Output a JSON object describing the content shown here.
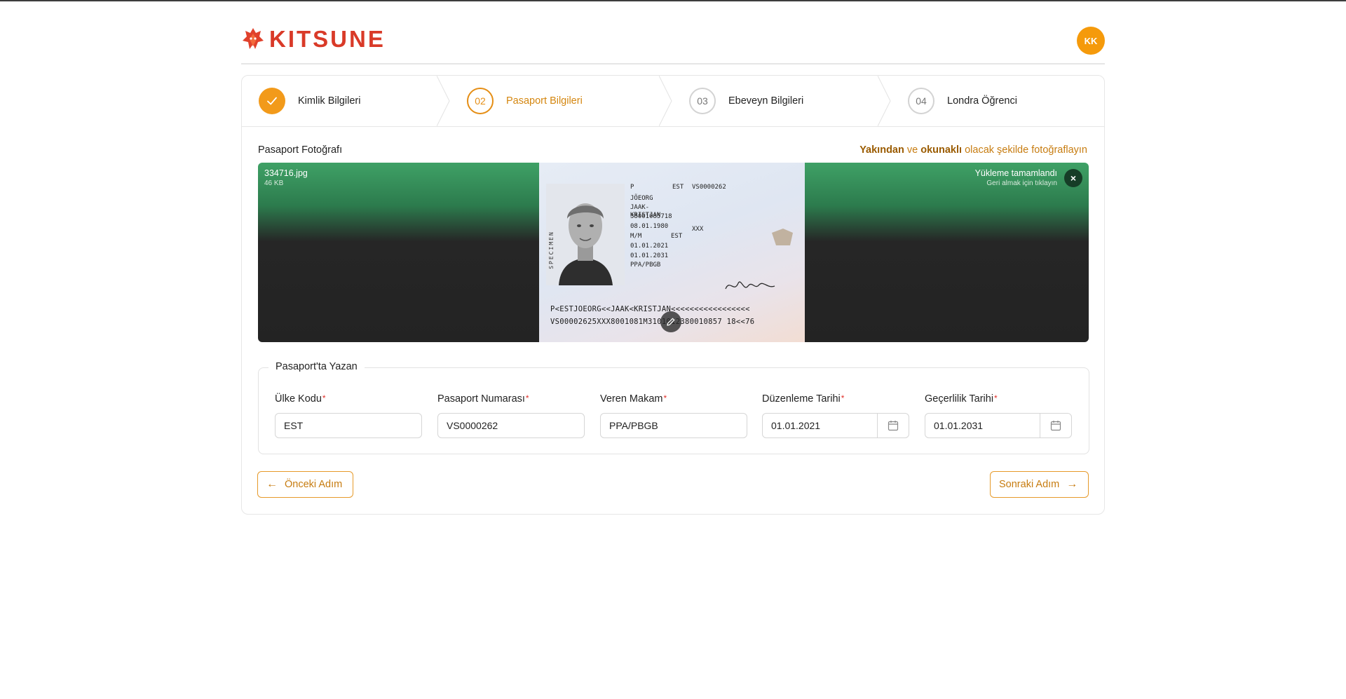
{
  "brand": {
    "name": "KITSUNE",
    "logo_icon": "fox-icon",
    "color": "#d93a28"
  },
  "user": {
    "initials": "KK",
    "color": "#f59a0b"
  },
  "steps": [
    {
      "number": "",
      "label": "Kimlik Bilgileri",
      "state": "done",
      "icon": "check-icon"
    },
    {
      "number": "02",
      "label": "Pasaport Bilgileri",
      "state": "active"
    },
    {
      "number": "03",
      "label": "Ebeveyn Bilgileri",
      "state": "pending"
    },
    {
      "number": "04",
      "label": "Londra Öğrenci",
      "state": "pending"
    }
  ],
  "photo_section": {
    "title": "Pasaport Fotoğrafı",
    "hint_bold1": "Yakından",
    "hint_mid": " ve ",
    "hint_bold2": "okunaklı",
    "hint_end": " olacak şekilde fotoğraflayın"
  },
  "upload": {
    "file_name": "334716.jpg",
    "file_size": "46 KB",
    "status": "Yükleme tamamlandı",
    "status_sub": "Geri almak için tıklayın",
    "close_icon": "close-icon",
    "edit_icon": "edit-icon"
  },
  "passport_image": {
    "specimen": "SPECIMEN",
    "type": "P",
    "country": "EST",
    "number": "VS0000262",
    "surname": "JÕEORG",
    "given_names": "JAAK-KRISTJAN",
    "personal_code": "38001085718",
    "birth_date": "08.01.1980",
    "sex": "M/M",
    "place_of_birth": "EST",
    "issue_date": "01.01.2021",
    "expiry_date": "01.01.2031",
    "authority": "PPA/PBGB",
    "height": "XXX",
    "mrz1": "P<ESTJOEORG<<JAAK<KRISTJAN<<<<<<<<<<<<<<<<<",
    "mrz2": "VS00002625XXX8001081M3101012380010857 18<<76"
  },
  "passport_form": {
    "legend": "Pasaport'ta Yazan",
    "required_mark": "*",
    "fields": [
      {
        "label": "Ülke Kodu",
        "value": "EST"
      },
      {
        "label": "Pasaport Numarası",
        "value": "VS0000262"
      },
      {
        "label": "Veren Makam",
        "value": "PPA/PBGB"
      },
      {
        "label": "Düzenleme Tarihi",
        "value": "01.01.2021",
        "icon": "calendar-icon"
      },
      {
        "label": "Geçerlilik Tarihi",
        "value": "01.01.2031",
        "icon": "calendar-icon"
      }
    ]
  },
  "nav": {
    "prev_label": "Önceki Adım",
    "next_label": "Sonraki Adım",
    "prev_icon": "arrow-left-icon",
    "next_icon": "arrow-right-icon",
    "accent": "#e69a2a"
  }
}
